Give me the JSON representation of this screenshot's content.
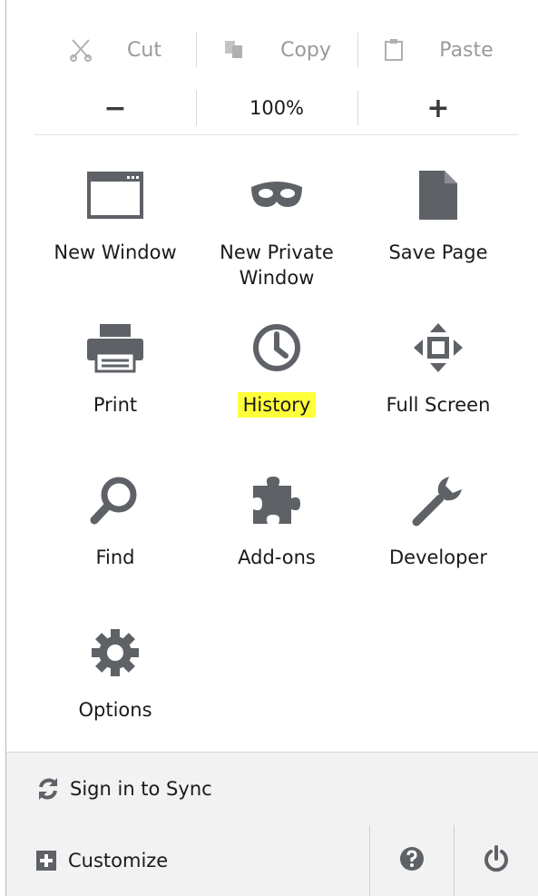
{
  "edit": {
    "cut_label": "Cut",
    "copy_label": "Copy",
    "paste_label": "Paste"
  },
  "zoom": {
    "decrease_symbol": "−",
    "level": "100%",
    "increase_symbol": "+"
  },
  "items": [
    {
      "label": "New Window",
      "icon": "window-icon"
    },
    {
      "label": "New Private Window",
      "icon": "mask-icon"
    },
    {
      "label": "Save Page",
      "icon": "page-icon"
    },
    {
      "label": "Print",
      "icon": "printer-icon"
    },
    {
      "label": "History",
      "icon": "clock-icon",
      "highlighted": true
    },
    {
      "label": "Full Screen",
      "icon": "fullscreen-icon"
    },
    {
      "label": "Find",
      "icon": "magnifier-icon"
    },
    {
      "label": "Add-ons",
      "icon": "puzzle-icon"
    },
    {
      "label": "Developer",
      "icon": "wrench-icon"
    },
    {
      "label": "Options",
      "icon": "gear-icon"
    }
  ],
  "footer": {
    "sync_label": "Sign in to Sync",
    "customize_label": "Customize"
  },
  "colors": {
    "icon_gray": "#5e6166",
    "highlight": "#ffff3a",
    "disabled_text": "#9a9a9a"
  }
}
